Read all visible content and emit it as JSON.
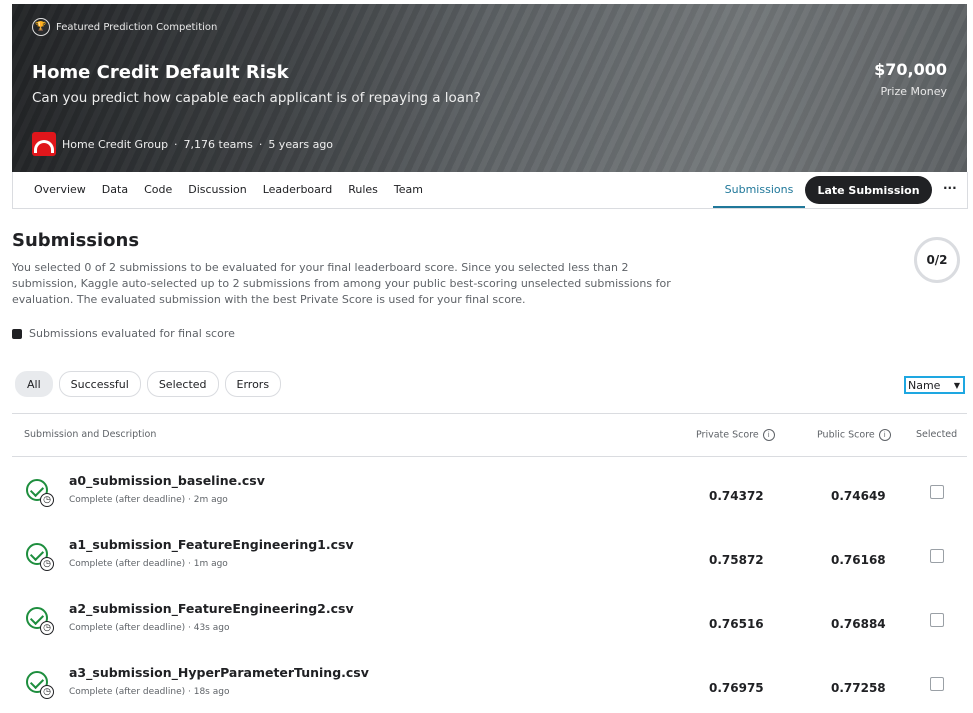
{
  "hero": {
    "featured": "Featured Prediction Competition",
    "title": "Home Credit Default Risk",
    "subtitle": "Can you predict how capable each applicant is of repaying a loan?",
    "host": "Home Credit Group",
    "teams": "7,176 teams",
    "age": "5 years ago",
    "prize_amount": "$70,000",
    "prize_label": "Prize Money"
  },
  "nav": {
    "tabs": [
      "Overview",
      "Data",
      "Code",
      "Discussion",
      "Leaderboard",
      "Rules",
      "Team"
    ],
    "active_tab": "Submissions",
    "late_submission": "Late Submission",
    "more": "···"
  },
  "submissions": {
    "title": "Submissions",
    "description": "You selected 0 of 2 submissions to be evaluated for your final leaderboard score. Since you selected less than 2 submission, Kaggle auto-selected up to 2 submissions from among your public best-scoring unselected submissions for evaluation. The evaluated submission with the best Private Score is used for your final score.",
    "selected_count": "0/2",
    "legend": "Submissions evaluated for final score",
    "filters": [
      "All",
      "Successful",
      "Selected",
      "Errors"
    ],
    "sort": "Name"
  },
  "table": {
    "headers": {
      "submission": "Submission and Description",
      "private": "Private Score",
      "public": "Public Score",
      "selected": "Selected"
    },
    "rows": [
      {
        "name": "a0_submission_baseline.csv",
        "status": "Complete (after deadline) · 2m ago",
        "private": "0.74372",
        "public": "0.74649"
      },
      {
        "name": "a1_submission_FeatureEngineering1.csv",
        "status": "Complete (after deadline) · 1m ago",
        "private": "0.75872",
        "public": "0.76168"
      },
      {
        "name": "a2_submission_FeatureEngineering2.csv",
        "status": "Complete (after deadline) · 43s ago",
        "private": "0.76516",
        "public": "0.76884"
      },
      {
        "name": "a3_submission_HyperParameterTuning.csv",
        "status": "Complete (after deadline) · 18s ago",
        "private": "0.76975",
        "public": "0.77258"
      }
    ]
  }
}
